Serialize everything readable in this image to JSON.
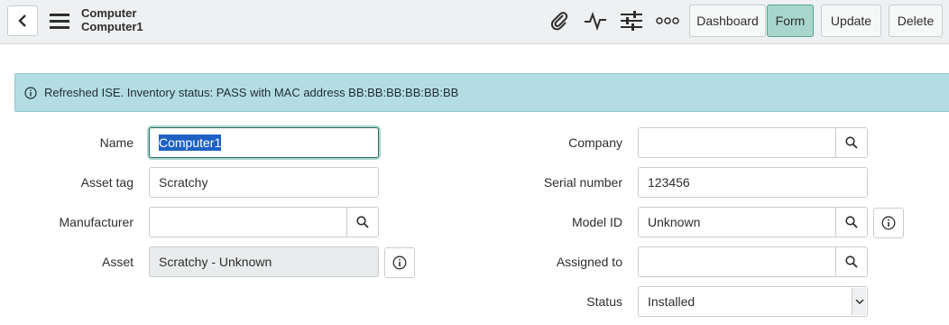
{
  "header": {
    "title": "Computer",
    "subtitle": "Computer1",
    "icons": [
      "back-icon",
      "menu-icon",
      "paperclip-icon",
      "activity-icon",
      "sliders-icon",
      "more-icon"
    ],
    "buttons": {
      "dashboard": "Dashboard",
      "form": "Form",
      "update": "Update",
      "delete": "Delete"
    },
    "active_button": "Form"
  },
  "banner": {
    "message": "Refreshed ISE. Inventory status: PASS with MAC address BB:BB:BB:BB:BB:BB"
  },
  "form": {
    "left": {
      "name": {
        "label": "Name",
        "value": "Computer1"
      },
      "asset_tag": {
        "label": "Asset tag",
        "value": "Scratchy"
      },
      "manufacturer": {
        "label": "Manufacturer",
        "value": ""
      },
      "asset": {
        "label": "Asset",
        "value": "Scratchy - Unknown"
      }
    },
    "right": {
      "company": {
        "label": "Company",
        "value": ""
      },
      "serial_number": {
        "label": "Serial number",
        "value": "123456"
      },
      "model_id": {
        "label": "Model ID",
        "value": "Unknown"
      },
      "assigned_to": {
        "label": "Assigned to",
        "value": ""
      },
      "status": {
        "label": "Status",
        "value": "Installed"
      }
    }
  },
  "colors": {
    "header_bg": "#eef0f1",
    "banner_bg": "#b4dde3",
    "active_button": "#a8d6cc",
    "selection": "#1e61c4"
  }
}
